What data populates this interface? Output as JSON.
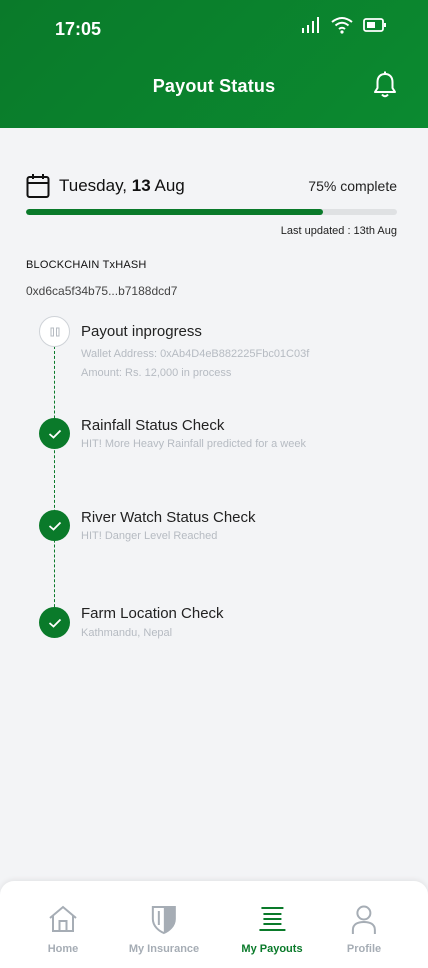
{
  "status_bar": {
    "time": "17:05"
  },
  "header": {
    "title": "Payout Status",
    "icon": "bell-icon"
  },
  "date_row": {
    "weekday": "Tuesday,",
    "day": "13",
    "month": "Aug",
    "progress_text": "75% complete",
    "progress_fraction": 0.8,
    "last_updated": "Last updated : 13th Aug"
  },
  "blockchain": {
    "label": "BLOCKCHAIN TxHASH",
    "hash": "0xd6ca5f34b75...b7188dcd7"
  },
  "steps": [
    {
      "title": "Payout inprogress",
      "status": "pending",
      "subs": [
        "Wallet Address: 0xAb4D4eB882225Fbc01C03f",
        "Amount: Rs. 12,000 in process"
      ]
    },
    {
      "title": "Rainfall Status Check",
      "status": "done",
      "subs": [
        "HIT! More Heavy Rainfall predicted for a week"
      ]
    },
    {
      "title": "River Watch Status Check",
      "status": "done",
      "subs": [
        "HIT! Danger Level Reached"
      ]
    },
    {
      "title": "Farm Location Check",
      "status": "done",
      "subs": [
        "Kathmandu, Nepal"
      ]
    }
  ],
  "nav": [
    {
      "label": "Home",
      "icon": "home-icon",
      "active": false
    },
    {
      "label": "My Insurance",
      "icon": "shield-icon",
      "active": false
    },
    {
      "label": "My Payouts",
      "icon": "payouts-icon",
      "active": true
    },
    {
      "label": "Profile",
      "icon": "user-icon",
      "active": false
    }
  ],
  "colors": {
    "brand_green": "#0a7a2a",
    "muted": "#a6adb5"
  }
}
